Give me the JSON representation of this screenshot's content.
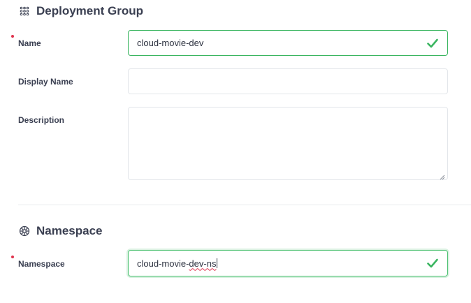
{
  "deployment_group": {
    "title": "Deployment Group",
    "icon": "grid-dots-icon",
    "name": {
      "label": "Name",
      "value": "cloud-movie-dev",
      "required": true,
      "valid": true
    },
    "display_name": {
      "label": "Display Name",
      "value": ""
    },
    "description": {
      "label": "Description",
      "value": ""
    }
  },
  "namespace_section": {
    "title": "Namespace",
    "icon": "gear-network-icon",
    "namespace": {
      "label": "Namespace",
      "value_prefix": "cloud-movie-",
      "value_misspelled": "dev-ns",
      "required": true,
      "valid": true
    }
  },
  "colors": {
    "valid": "#3ab560",
    "required": "#e0334d",
    "text": "#3a3f51",
    "border": "#e3e6ea"
  }
}
